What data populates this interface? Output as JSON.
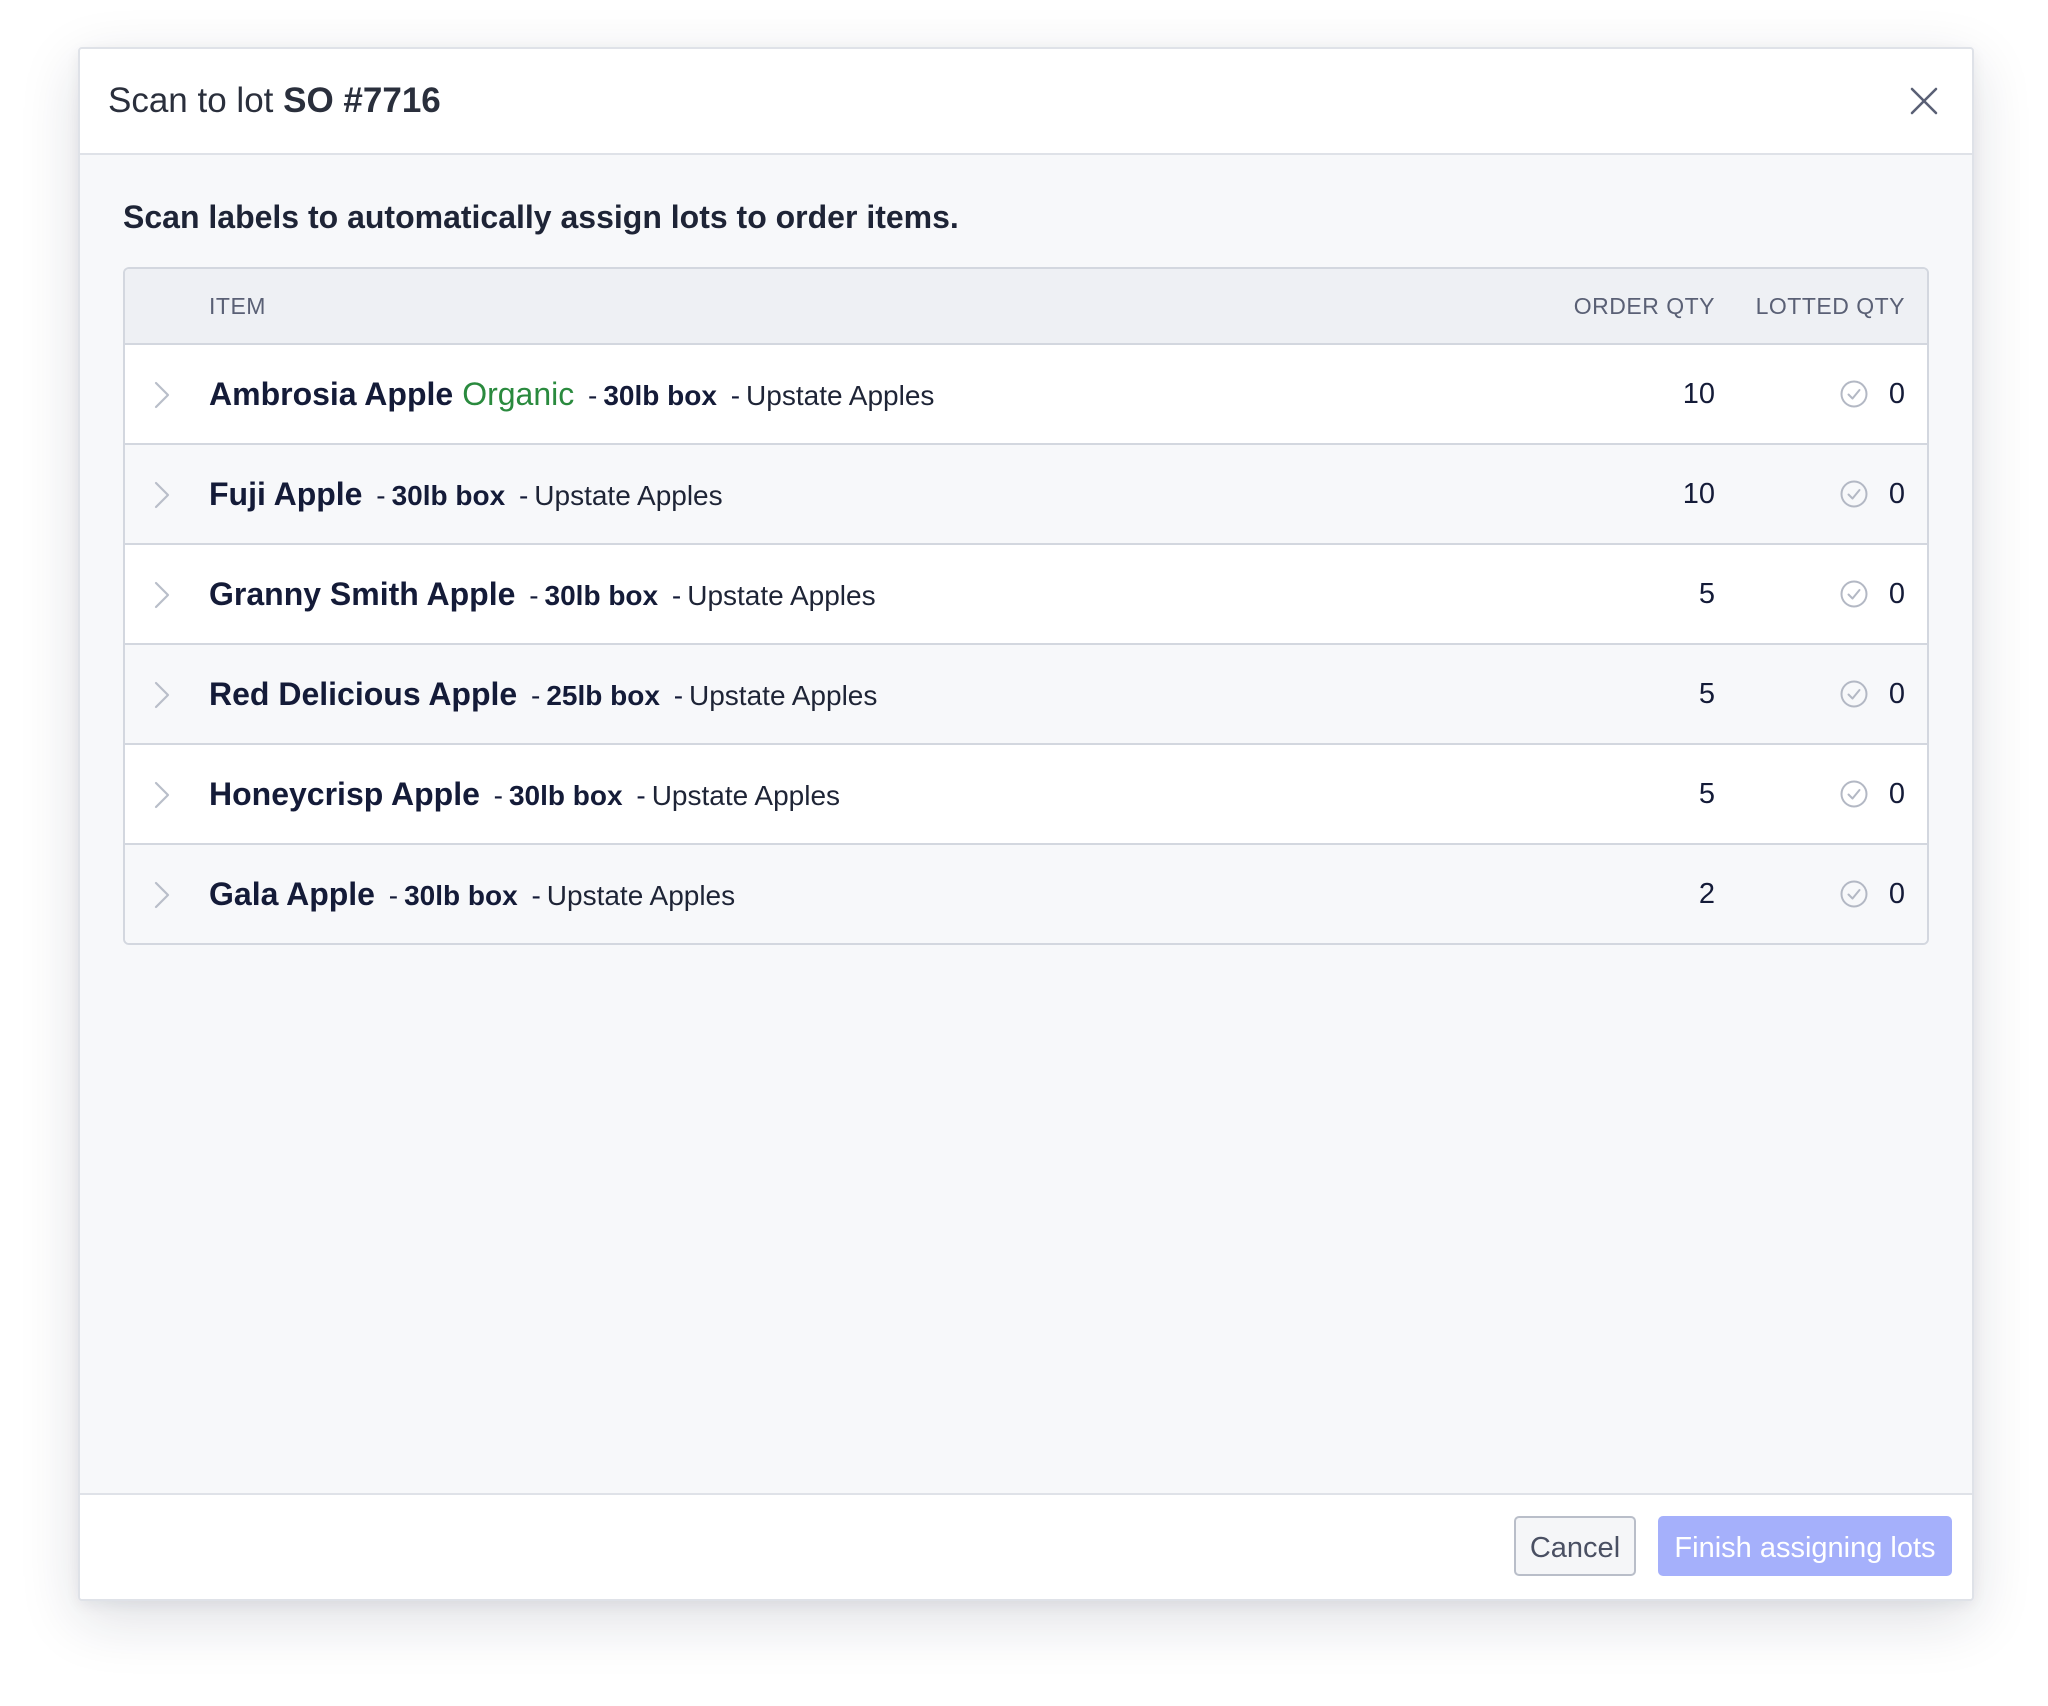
{
  "dialog": {
    "title_prefix": "Scan to lot",
    "title_order": "SO #7716",
    "close_icon": "close-icon",
    "instructions": "Scan labels to automatically assign lots to order items."
  },
  "table": {
    "columns": {
      "item": "ITEM",
      "order_qty": "ORDER QTY",
      "lotted_qty": "LOTTED QTY"
    },
    "rows": [
      {
        "name": "Ambrosia Apple",
        "tag": "Organic",
        "sep1": "-",
        "pack": "30lb box",
        "sep2": "-",
        "vendor": "Upstate Apples",
        "order_qty": "10",
        "lotted_qty": "0"
      },
      {
        "name": "Fuji Apple",
        "tag": "",
        "sep1": "-",
        "pack": "30lb box",
        "sep2": "-",
        "vendor": "Upstate Apples",
        "order_qty": "10",
        "lotted_qty": "0"
      },
      {
        "name": "Granny Smith Apple",
        "tag": "",
        "sep1": "-",
        "pack": "30lb box",
        "sep2": "-",
        "vendor": "Upstate Apples",
        "order_qty": "5",
        "lotted_qty": "0"
      },
      {
        "name": "Red Delicious Apple",
        "tag": "",
        "sep1": "-",
        "pack": "25lb box",
        "sep2": "-",
        "vendor": "Upstate Apples",
        "order_qty": "5",
        "lotted_qty": "0"
      },
      {
        "name": "Honeycrisp Apple",
        "tag": "",
        "sep1": "-",
        "pack": "30lb box",
        "sep2": "-",
        "vendor": "Upstate Apples",
        "order_qty": "5",
        "lotted_qty": "0"
      },
      {
        "name": "Gala Apple",
        "tag": "",
        "sep1": "-",
        "pack": "30lb box",
        "sep2": "-",
        "vendor": "Upstate Apples",
        "order_qty": "2",
        "lotted_qty": "0"
      }
    ]
  },
  "footer": {
    "cancel_label": "Cancel",
    "finish_label": "Finish assigning lots"
  },
  "colors": {
    "organic_tag": "#2a8a3e",
    "primary_button_disabled": "#a5b0fb",
    "check_icon": "#b3b8c4"
  }
}
